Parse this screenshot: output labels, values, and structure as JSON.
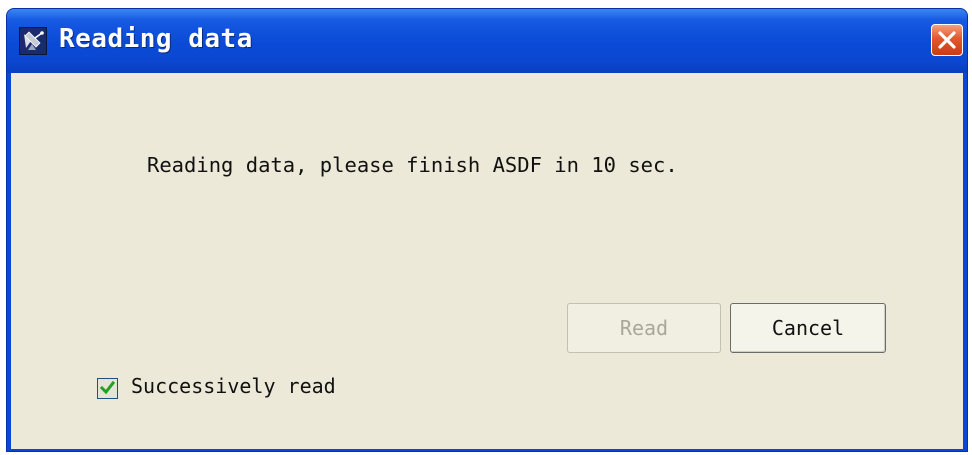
{
  "window": {
    "title": "Reading data",
    "icon": "satellite-icon"
  },
  "dialog": {
    "message": "Reading data, please finish ASDF in 10 sec."
  },
  "buttons": {
    "read_label": "Read",
    "read_enabled": false,
    "cancel_label": "Cancel"
  },
  "options": {
    "successive_read_label": "Successively read",
    "successive_read_checked": true
  },
  "colors": {
    "title_bar": "#0a4ad6",
    "client_background": "#ece9d8",
    "close_button": "#e2582e",
    "checkmark": "#21a121"
  }
}
